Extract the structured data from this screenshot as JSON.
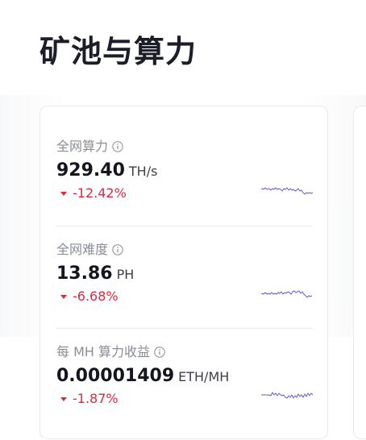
{
  "page": {
    "title": "矿池与算力"
  },
  "metrics": [
    {
      "label": "全网算力",
      "value": "929.40",
      "unit": "TH/s",
      "change": "-12.42%",
      "trend_color": "#6b5bd2",
      "icon": "info-icon"
    },
    {
      "label": "全网难度",
      "value": "13.86",
      "unit": "PH",
      "change": "-6.68%",
      "trend_color": "#6b5bd2",
      "icon": "info-icon"
    },
    {
      "label": "每 MH 算力收益",
      "value": "0.00001409",
      "unit": "ETH/MH",
      "change": "-1.87%",
      "trend_color": "#6b5bd2",
      "icon": "info-icon"
    }
  ],
  "colors": {
    "negative": "#e0273f",
    "sparkline": "#6b5bd2"
  }
}
